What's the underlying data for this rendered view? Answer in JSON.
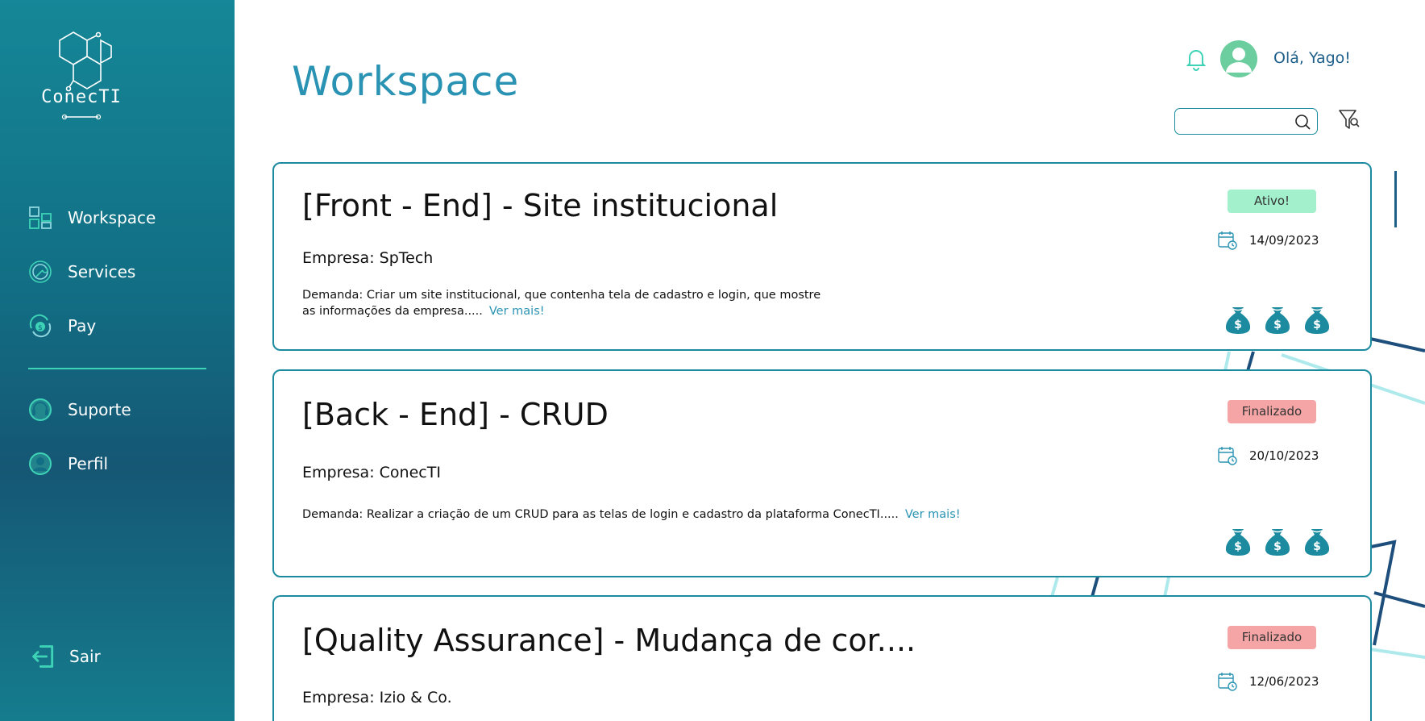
{
  "brand": {
    "name": "ConecTI"
  },
  "sidebar": {
    "items": [
      {
        "label": "Workspace",
        "icon": "workspace-grid-icon"
      },
      {
        "label": "Services",
        "icon": "wrench-gear-icon"
      },
      {
        "label": "Pay",
        "icon": "dollar-cycle-icon"
      },
      {
        "label": "Suporte",
        "icon": "headset-icon"
      },
      {
        "label": "Perfil",
        "icon": "user-circle-icon"
      }
    ],
    "logout_label": "Sair"
  },
  "header": {
    "title": "Workspace",
    "greeting": "Olá, Yago!",
    "search_placeholder": ""
  },
  "colors": {
    "accent": "#2a93b3",
    "sidebar_top": "#158797",
    "sidebar_mid": "#155774",
    "card_border": "#1c8b9f",
    "badge_active": "#a3f0cd",
    "badge_done": "#f5a5a5",
    "mint": "#3ed3b6"
  },
  "projects": [
    {
      "title": "[Front - End] - Site institucional",
      "company": "Empresa: SpTech",
      "demand": "Demanda: Criar um site institucional, que contenha  tela de cadastro e login, que mostre as informações da empresa.....",
      "more_label": "Ver mais!",
      "status": "Ativo!",
      "date": "14/09/2023",
      "price_level": 3
    },
    {
      "title": "[Back - End] - CRUD",
      "company": "Empresa: ConecTI",
      "demand": "Demanda: Realizar a criação de um CRUD para as telas de login e cadastro da plataforma ConecTI.....",
      "more_label": "Ver mais!",
      "status": "Finalizado",
      "date": "20/10/2023",
      "price_level": 3
    },
    {
      "title": "[Quality Assurance] - Mudança de cor....",
      "company": "Empresa: Izio & Co.",
      "status": "Finalizado",
      "date": "12/06/2023"
    }
  ]
}
